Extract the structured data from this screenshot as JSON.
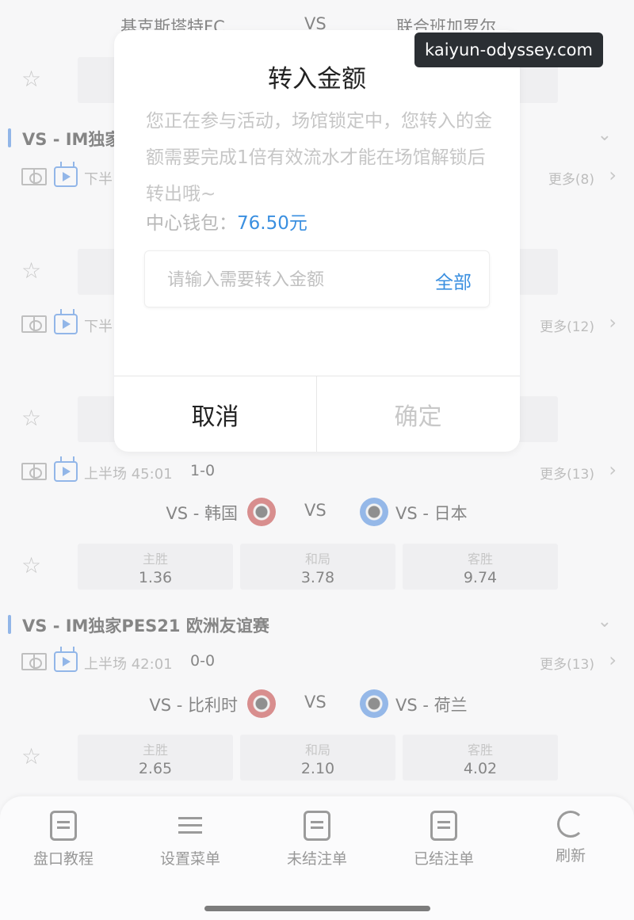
{
  "top_match": {
    "home": "基克斯塔特FC",
    "vs": "VS",
    "away": "联合班加罗尔"
  },
  "league1": {
    "title": "VS - IM独家",
    "rows": [
      {
        "period": "下半",
        "more": "更多(8)"
      },
      {
        "period": "下半",
        "more": "更多(12)"
      }
    ]
  },
  "match3": {
    "period": "上半场 45:01",
    "score": "1-0",
    "more": "更多(13)",
    "home": "VS - 韩国",
    "vs": "VS",
    "away": "VS - 日本",
    "odds": [
      {
        "label": "主胜",
        "value": "1.36"
      },
      {
        "label": "和局",
        "value": "3.78"
      },
      {
        "label": "客胜",
        "value": "9.74"
      }
    ]
  },
  "league2": {
    "title": "VS - IM独家PES21 欧洲友谊赛",
    "period": "上半场 42:01",
    "score": "0-0",
    "more": "更多(13)",
    "home": "VS - 比利时",
    "vs": "VS",
    "away": "VS - 荷兰",
    "odds": [
      {
        "label": "主胜",
        "value": "2.65"
      },
      {
        "label": "和局",
        "value": "2.10"
      },
      {
        "label": "客胜",
        "value": "4.02"
      }
    ]
  },
  "nav": [
    {
      "label": "盘口教程",
      "icon": "tutorial-icon"
    },
    {
      "label": "设置菜单",
      "icon": "settings-sliders-icon"
    },
    {
      "label": "未结注单",
      "icon": "clipboard-icon"
    },
    {
      "label": "已结注单",
      "icon": "settled-bill-icon"
    },
    {
      "label": "刷新",
      "icon": "refresh-icon"
    }
  ],
  "dialog": {
    "title": "转入金额",
    "message": "您正在参与活动，场馆锁定中，您转入的金额需要完成1倍有效流水才能在场馆解锁后转出哦~",
    "wallet_label": "中心钱包：",
    "wallet_value": "76.50元",
    "input_placeholder": "请输入需要转入金额",
    "all_label": "全部",
    "cancel_label": "取消",
    "confirm_label": "确定"
  },
  "watermark": "kaiyun-odyssey.com",
  "colors": {
    "accent": "#3a8fe0",
    "league_bar": "#3a7bd5",
    "badge_red": "#b83232",
    "badge_blue": "#3f7ed6"
  }
}
